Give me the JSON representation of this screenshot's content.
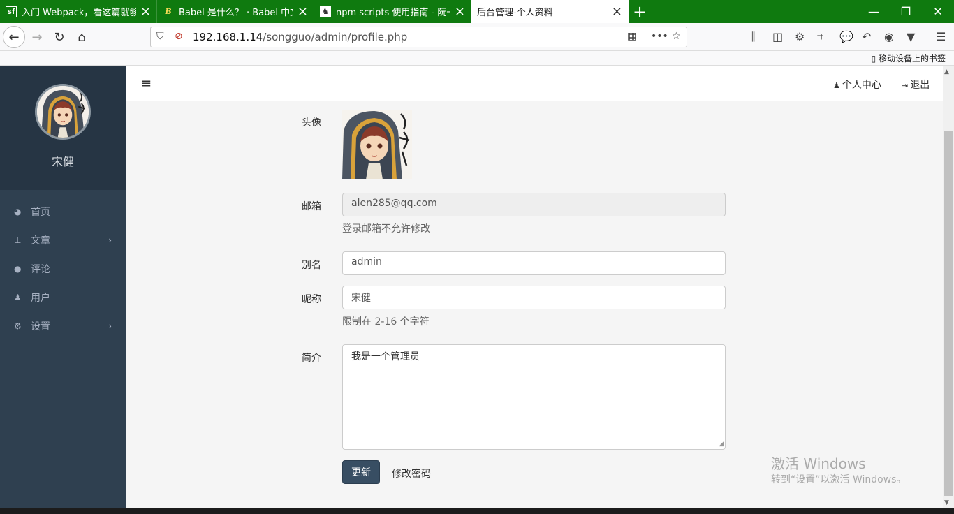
{
  "browser": {
    "tabs": [
      {
        "icon": "sf",
        "title": "入门 Webpack，看这篇就够了",
        "active": false
      },
      {
        "icon": "B",
        "title": "Babel 是什么？ · Babel 中文网",
        "active": false
      },
      {
        "icon": "npm",
        "title": "npm scripts 使用指南 - 阮一峰",
        "active": false
      },
      {
        "icon": "",
        "title": "后台管理-个人资料",
        "active": true
      }
    ],
    "url_host": "192.168.1.14",
    "url_path": "/songguo/admin/profile.php",
    "mobile_bookmarks": "移动设备上的书签"
  },
  "sidebar": {
    "user_name": "宋健",
    "menu": [
      {
        "label": "首页",
        "icon": "dashboard-icon",
        "has_children": false
      },
      {
        "label": "文章",
        "icon": "thumbtack-icon",
        "has_children": true
      },
      {
        "label": "评论",
        "icon": "comments-icon",
        "has_children": false
      },
      {
        "label": "用户",
        "icon": "users-icon",
        "has_children": false
      },
      {
        "label": "设置",
        "icon": "cogs-icon",
        "has_children": true
      }
    ]
  },
  "header": {
    "profile_link": "个人中心",
    "logout_link": "退出"
  },
  "form": {
    "avatar_label": "头像",
    "email_label": "邮箱",
    "email_value": "alen285@qq.com",
    "email_help": "登录邮箱不允许修改",
    "slug_label": "别名",
    "slug_value": "admin",
    "nickname_label": "昵称",
    "nickname_value": "宋健",
    "nickname_help": "限制在 2-16 个字符",
    "bio_label": "简介",
    "bio_value": "我是一个管理员",
    "update_button": "更新",
    "change_password_link": "修改密码"
  },
  "watermark": {
    "line1": "激活 Windows",
    "line2": "转到“设置”以激活 Windows。"
  },
  "colors": {
    "tabbar": "#0f7a0f",
    "sidebar": "#2f4050",
    "primary_button": "#384e63"
  }
}
